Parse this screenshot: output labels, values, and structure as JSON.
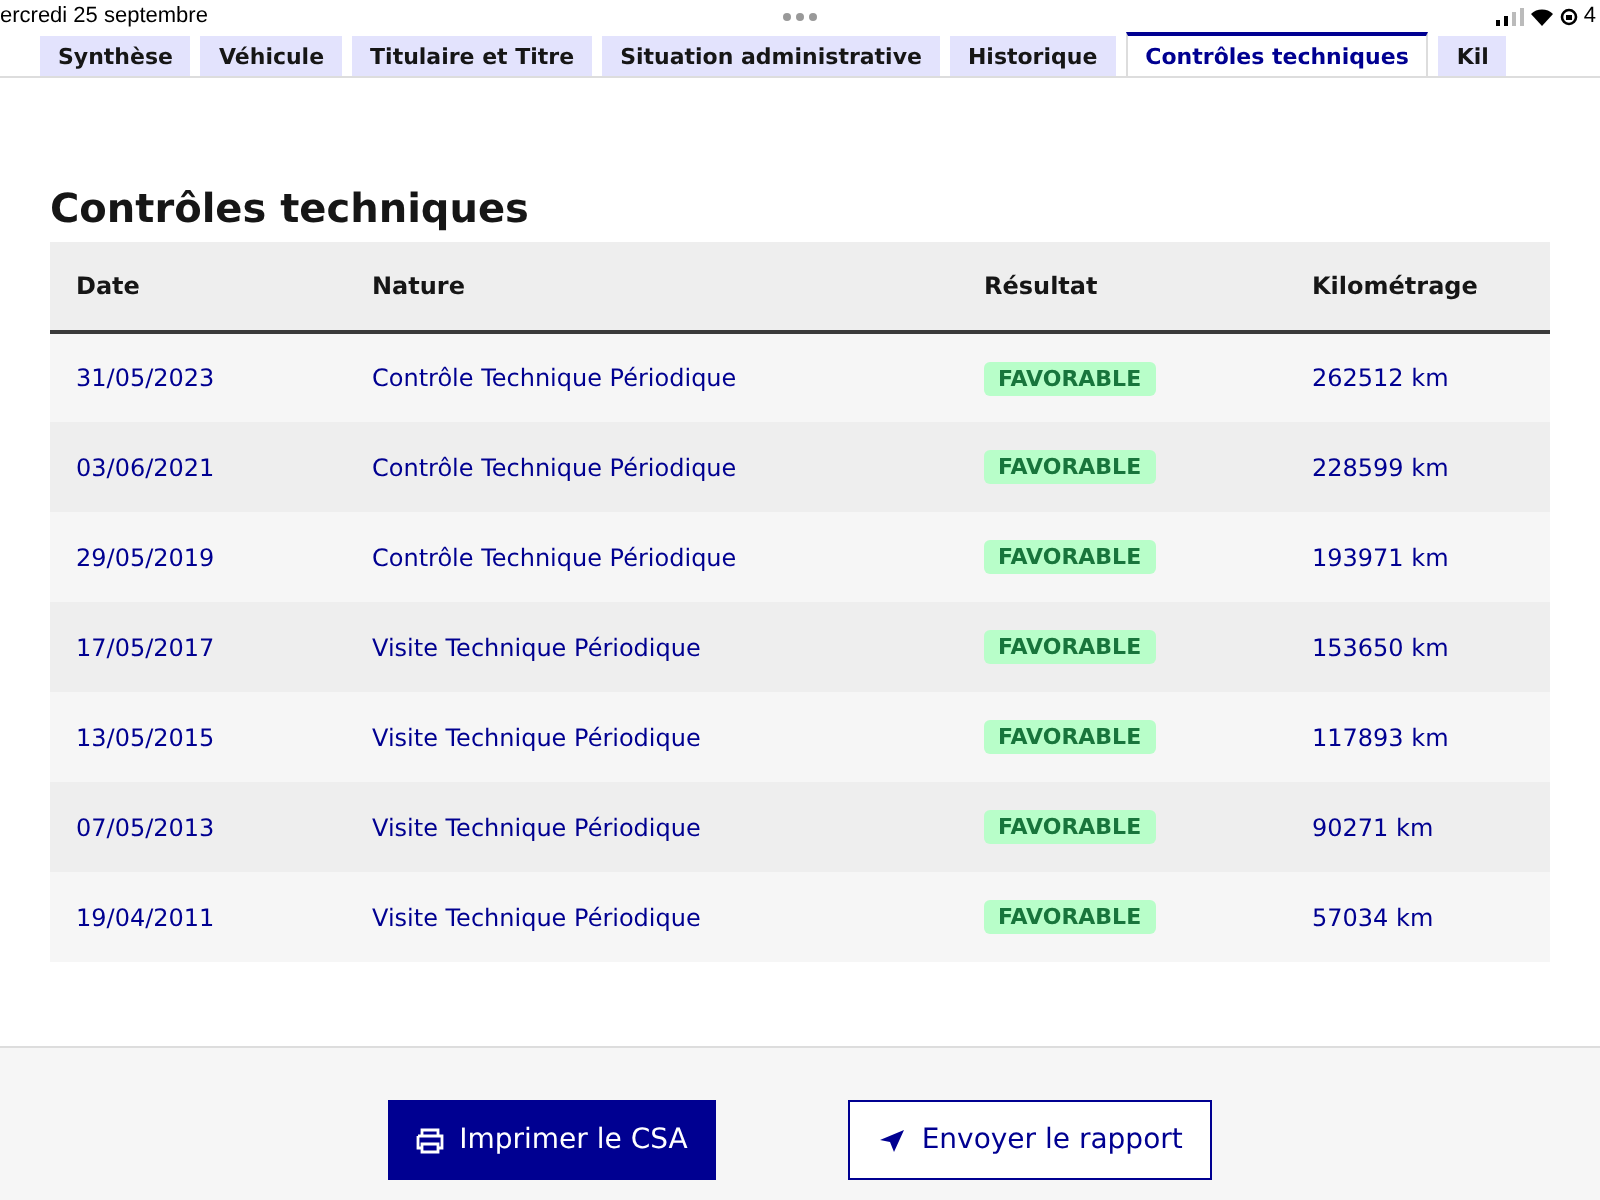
{
  "status_bar": {
    "date": "ercredi 25 septembre",
    "battery": "4"
  },
  "tabs": [
    {
      "label": "Synthèse",
      "selected": false
    },
    {
      "label": "Véhicule",
      "selected": false
    },
    {
      "label": "Titulaire et Titre",
      "selected": false
    },
    {
      "label": "Situation administrative",
      "selected": false
    },
    {
      "label": "Historique",
      "selected": false
    },
    {
      "label": "Contrôles techniques",
      "selected": true
    },
    {
      "label": "Kil",
      "selected": false
    }
  ],
  "section": {
    "title": "Contrôles techniques"
  },
  "table": {
    "columns": [
      "Date",
      "Nature",
      "Résultat",
      "Kilométrage"
    ],
    "rows": [
      {
        "date": "31/05/2023",
        "nature": "Contrôle Technique Périodique",
        "result": "FAVORABLE",
        "mileage": "262512 km"
      },
      {
        "date": "03/06/2021",
        "nature": "Contrôle Technique Périodique",
        "result": "FAVORABLE",
        "mileage": "228599 km"
      },
      {
        "date": "29/05/2019",
        "nature": "Contrôle Technique Périodique",
        "result": "FAVORABLE",
        "mileage": "193971 km"
      },
      {
        "date": "17/05/2017",
        "nature": "Visite Technique Périodique",
        "result": "FAVORABLE",
        "mileage": "153650 km"
      },
      {
        "date": "13/05/2015",
        "nature": "Visite Technique Périodique",
        "result": "FAVORABLE",
        "mileage": "117893 km"
      },
      {
        "date": "07/05/2013",
        "nature": "Visite Technique Périodique",
        "result": "FAVORABLE",
        "mileage": "90271 km"
      },
      {
        "date": "19/04/2011",
        "nature": "Visite Technique Périodique",
        "result": "FAVORABLE",
        "mileage": "57034 km"
      }
    ]
  },
  "buttons": [
    {
      "label": "Imprimer le CSA",
      "kind": "primary"
    },
    {
      "label": "Envoyer le rapport",
      "kind": "secondary"
    }
  ]
}
